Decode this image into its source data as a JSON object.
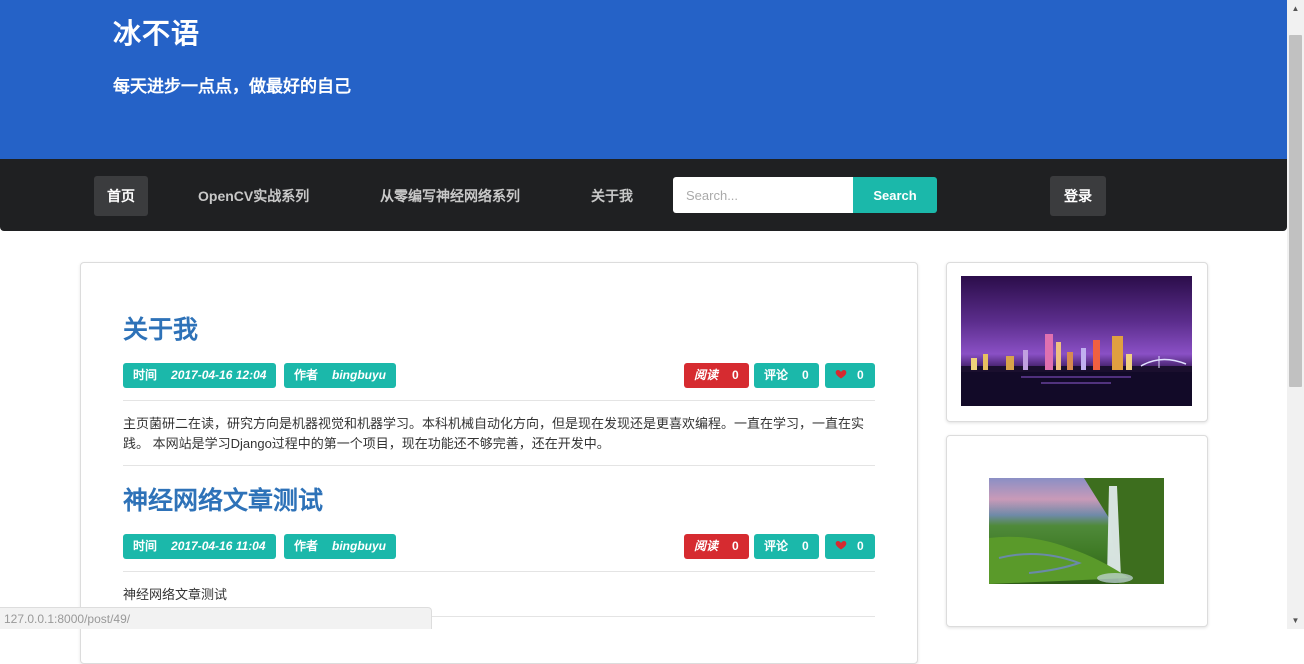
{
  "header": {
    "title": "冰不语",
    "subtitle": "每天进步一点点，做最好的自己"
  },
  "nav": {
    "items": [
      {
        "label": "首页",
        "active": true
      },
      {
        "label": "OpenCV实战系列",
        "active": false
      },
      {
        "label": "从零编写神经网络系列",
        "active": false
      },
      {
        "label": "关于我",
        "active": false
      }
    ],
    "search_placeholder": "Search...",
    "search_button": "Search",
    "login": "登录"
  },
  "posts": [
    {
      "title": "关于我",
      "time_label": "时间",
      "time": "2017-04-16 12:04",
      "author_label": "作者",
      "author": "bingbuyu",
      "read_label": "阅读",
      "reads": "0",
      "comment_label": "评论",
      "comments": "0",
      "likes": "0",
      "excerpt": "主页菌研二在读，研究方向是机器视觉和机器学习。本科机械自动化方向，但是现在发现还是更喜欢编程。一直在学习，一直在实践。 本网站是学习Django过程中的第一个项目，现在功能还不够完善，还在开发中。"
    },
    {
      "title": "神经网络文章测试",
      "time_label": "时间",
      "time": "2017-04-16 11:04",
      "author_label": "作者",
      "author": "bingbuyu",
      "read_label": "阅读",
      "reads": "0",
      "comment_label": "评论",
      "comments": "0",
      "likes": "0",
      "excerpt": "神经网络文章测试"
    }
  ],
  "status_bar": {
    "url": "127.0.0.1:8000/post/49/"
  },
  "colors": {
    "header_blue": "#2562c7",
    "navbar_dark": "#1f2022",
    "teal": "#1bb8aa",
    "red": "#d62b30",
    "title_blue": "#2e72b8"
  }
}
